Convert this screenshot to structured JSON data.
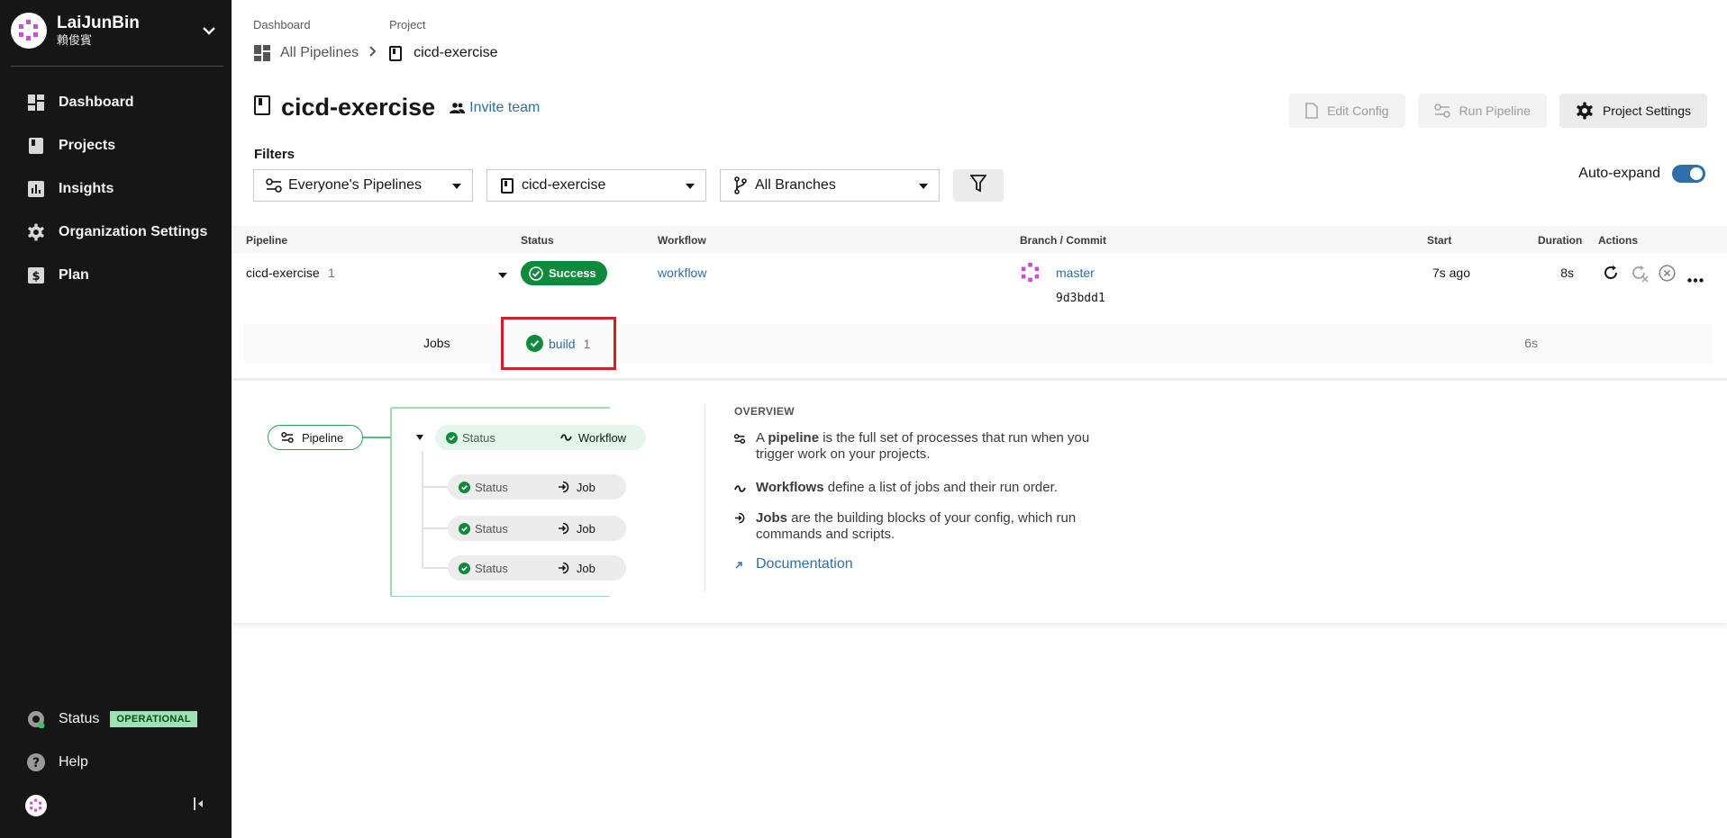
{
  "sidebar": {
    "org_name": "LaiJunBin",
    "org_sub": "賴俊賓",
    "nav": [
      {
        "label": "Dashboard",
        "icon": "dashboard-icon"
      },
      {
        "label": "Projects",
        "icon": "projects-icon"
      },
      {
        "label": "Insights",
        "icon": "insights-icon"
      },
      {
        "label": "Organization Settings",
        "icon": "gear-icon"
      },
      {
        "label": "Plan",
        "icon": "plan-icon"
      }
    ],
    "status_label": "Status",
    "status_badge": "OPERATIONAL",
    "help_label": "Help"
  },
  "breadcrumb": {
    "dashboard_label": "Dashboard",
    "project_label": "Project",
    "all_pipelines": "All Pipelines",
    "project_name": "cicd-exercise"
  },
  "header": {
    "title": "cicd-exercise",
    "invite": "Invite team",
    "edit_config": "Edit Config",
    "run_pipeline": "Run Pipeline",
    "project_settings": "Project Settings"
  },
  "filters": {
    "label": "Filters",
    "pipelines": "Everyone's Pipelines",
    "project": "cicd-exercise",
    "branches": "All Branches",
    "auto_expand": "Auto-expand",
    "auto_expand_on": true
  },
  "table": {
    "headers": {
      "pipeline": "Pipeline",
      "status": "Status",
      "workflow": "Workflow",
      "branch": "Branch / Commit",
      "start": "Start",
      "duration": "Duration",
      "actions": "Actions"
    },
    "row": {
      "pipeline": "cicd-exercise",
      "number": "1",
      "status": "Success",
      "workflow": "workflow",
      "branch": "master",
      "commit": "9d3bdd1",
      "start": "7s ago",
      "duration": "8s"
    },
    "jobs": {
      "label": "Jobs",
      "job_name": "build",
      "job_number": "1",
      "duration": "6s"
    }
  },
  "overview": {
    "diagram": {
      "pipeline": "Pipeline",
      "status": "Status",
      "workflow": "Workflow",
      "job": "Job"
    },
    "title": "OVERVIEW",
    "items": [
      {
        "bold": "pipeline",
        "pre": "A ",
        "post": " is the full set of processes that run when you trigger work on your projects."
      },
      {
        "bold": "Workflows",
        "pre": "",
        "post": " define a list of jobs and their run order."
      },
      {
        "bold": "Jobs",
        "pre": "",
        "post": " are the building blocks of your config, which run commands and scripts."
      }
    ],
    "documentation": "Documentation"
  },
  "colors": {
    "sidebar_bg": "#161616",
    "success_green": "#0f8a3c",
    "link_blue": "#2e6fa7",
    "highlight_red": "#d41e25"
  }
}
